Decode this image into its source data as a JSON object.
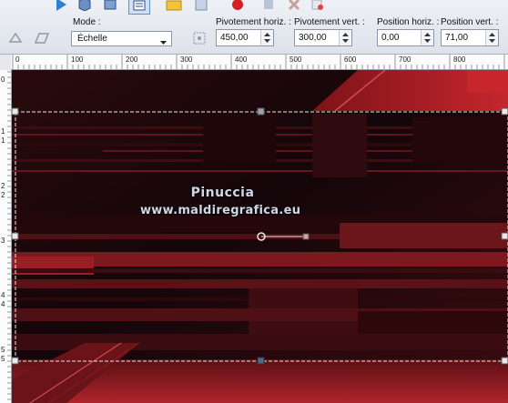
{
  "toolbar": {
    "mode_label": "Mode :",
    "mode_value": "Échelle",
    "pivot_h_label": "Pivotement horiz. :",
    "pivot_h_value": "450,00",
    "pivot_v_label": "Pivotement vert. :",
    "pivot_v_value": "300,00",
    "pos_h_label": "Position horiz. :",
    "pos_h_value": "0,00",
    "pos_v_label": "Position vert. :",
    "pos_v_value": "71,00"
  },
  "ruler": {
    "h_ticks": [
      "0",
      "100",
      "200",
      "300",
      "400",
      "500",
      "600",
      "700",
      "800"
    ],
    "v_ticks": [
      "0",
      "1",
      "1",
      "2",
      "2",
      "3",
      "4",
      "4",
      "5",
      "5"
    ]
  },
  "canvas": {
    "watermark_line1": "Pinuccia",
    "watermark_line2": "www.maldiregrafica.eu"
  },
  "colors": {
    "canvas_dark": "#1a0507",
    "canvas_red": "#b0242b",
    "selection_line": "#e9e9e9",
    "handle": "#4b6a88"
  }
}
